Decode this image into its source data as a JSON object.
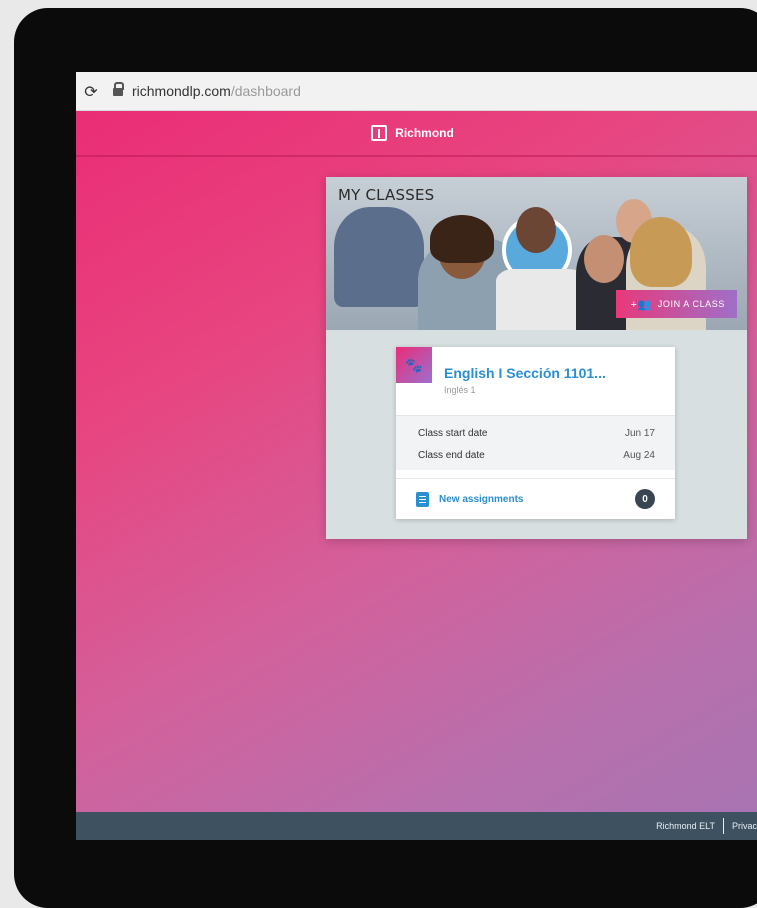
{
  "browser": {
    "url_host": "richmondlp.com",
    "url_path": "/dashboard"
  },
  "header": {
    "brand": "Richmond"
  },
  "classes_panel": {
    "title": "MY CLASSES",
    "join_button": "JOIN A CLASS"
  },
  "class_card": {
    "name": "English I Sección 1101...",
    "subtitle": "Inglés 1",
    "start_label": "Class start date",
    "start_value": "Jun 17",
    "end_label": "Class end date",
    "end_value": "Aug 24",
    "assignments_label": "New assignments",
    "assignments_count": "0"
  },
  "footer": {
    "company": "Richmond ELT",
    "privacy": "Privac"
  },
  "colors": {
    "accent_pink": "#ea2d76",
    "accent_purple": "#9c6fd0",
    "link_blue": "#2a8fd0",
    "footer_bg": "#3d5160"
  }
}
